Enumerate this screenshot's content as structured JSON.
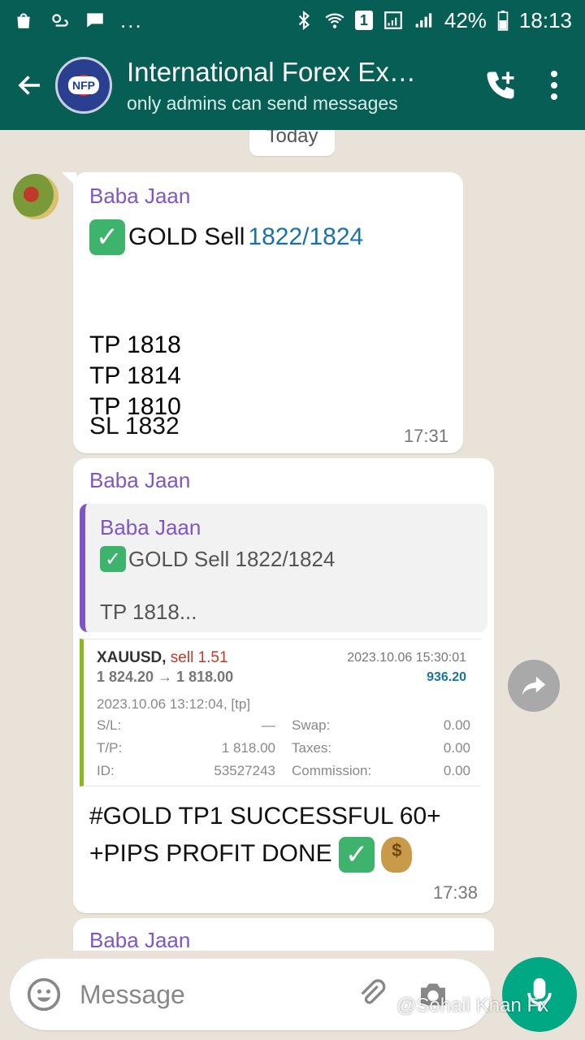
{
  "statusbar": {
    "dots": "...",
    "sim": "1",
    "battery": "42%",
    "time": "18:13"
  },
  "header": {
    "avatar_text": "NFP",
    "title": "International Forex Ex…",
    "subtitle": "only admins can send messages"
  },
  "chat": {
    "date_chip": "Today",
    "messages": [
      {
        "sender": "Baba Jaan",
        "line1_prefix": "GOLD Sell ",
        "line1_link": "1822/1824",
        "tp_lines": [
          "TP 1818",
          "TP 1814",
          "TP 1810"
        ],
        "sl": "SL 1832",
        "time": "17:31"
      },
      {
        "sender": "Baba Jaan",
        "quote": {
          "sender": "Baba Jaan",
          "line": "GOLD Sell 1822/1824",
          "tp": "TP 1818..."
        },
        "trade": {
          "symbol": "XAUUSD,",
          "side": "sell 1.51",
          "close_time": "2023.10.06 15:30:01",
          "prices": "1 824.20 → 1 818.00",
          "profit": "936.20",
          "open_time": "2023.10.06 13:12:04, [tp]",
          "rows": [
            {
              "k1": "S/L:",
              "v1": "—",
              "k2": "Swap:",
              "v2": "0.00"
            },
            {
              "k1": "T/P:",
              "v1": "1 818.00",
              "k2": "Taxes:",
              "v2": "0.00"
            },
            {
              "k1": "ID:",
              "v1": "53527243",
              "k2": "Commission:",
              "v2": "0.00"
            }
          ]
        },
        "body_line1": "#GOLD  TP1  SUCCESSFUL 60+",
        "body_line2": "+PIPS PROFIT DONE ",
        "time": "17:38"
      },
      {
        "sender": "Baba Jaan"
      }
    ]
  },
  "input": {
    "placeholder": "Message"
  },
  "watermark": "@Sohail Khan Fx",
  "colors": {
    "header": "#075e54",
    "sender": "#7e57c2",
    "link": "#1a73a8",
    "mic": "#00a884",
    "check": "#3db36b"
  }
}
